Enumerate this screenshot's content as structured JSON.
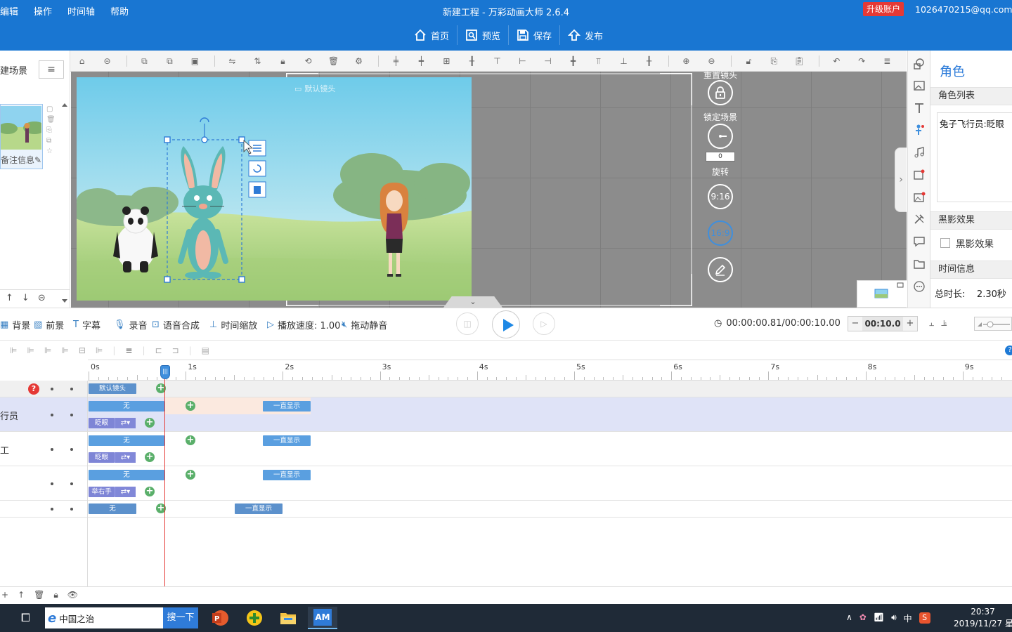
{
  "menu": {
    "items": [
      "编辑",
      "操作",
      "时间轴",
      "帮助"
    ]
  },
  "window": {
    "title": "新建工程 - 万彩动画大师 2.6.4"
  },
  "account": {
    "upgrade_label": "升级账户",
    "email": "1026470215@qq.com"
  },
  "actions": {
    "home": "首页",
    "preview": "预览",
    "save": "保存",
    "publish": "发布"
  },
  "scene_panel": {
    "new_scene": "建场景",
    "note": "备注信息"
  },
  "canvas": {
    "camera_label": "默认镜头",
    "reset_camera": "重置镜头",
    "lock_scene": "锁定场景",
    "rotation_value": "0",
    "rotate_label": "旋转",
    "ratio_916": "9:16",
    "ratio_169": "16:9"
  },
  "props": {
    "title": "角色",
    "role_list_head": "角色列表",
    "role_item": "兔子飞行员:眨眼",
    "shadow_head": "黑影效果",
    "shadow_label": "黑影效果",
    "time_head": "时间信息",
    "total_label": "总时长:",
    "total_value": "2.30秒"
  },
  "bottom_bar": {
    "background": "背景",
    "foreground": "前景",
    "subtitle": "字幕",
    "record": "录音",
    "tts": "语音合成",
    "time_scale": "时间缩放",
    "speed": "播放速度: 1.00",
    "mute": "拖动静音",
    "time": "00:00:00.81/00:00:10.00",
    "duration": "00:10.0"
  },
  "timeline": {
    "ticks": [
      "0s",
      "1s",
      "2s",
      "3s",
      "4s",
      "5s",
      "6s",
      "7s",
      "8s",
      "9s"
    ],
    "rows": [
      {
        "name": "",
        "clip": "默认镜头"
      },
      {
        "name": "行员",
        "enter": "无",
        "action": "眨眼",
        "exit": "一直显示"
      },
      {
        "name": "工",
        "enter": "无",
        "action": "眨眼",
        "exit": "一直显示"
      },
      {
        "name": "",
        "enter": "无",
        "action": "举右手",
        "exit": "一直显示"
      },
      {
        "name": "",
        "enter": "无",
        "exit": "一直显示"
      }
    ]
  },
  "taskbar": {
    "search_value": "中国之治",
    "search_btn": "搜一下",
    "app_am": "AM",
    "ime": "中",
    "time": "20:37",
    "date": "2019/11/27 星"
  },
  "colors": {
    "primary": "#1976d2",
    "accent": "#e53935",
    "key": "#5aaf6a"
  }
}
